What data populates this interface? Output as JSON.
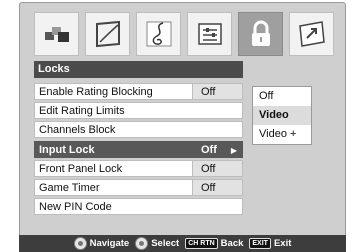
{
  "tabs": [
    {
      "icon": "picture-icon"
    },
    {
      "icon": "screen-icon"
    },
    {
      "icon": "music-icon"
    },
    {
      "icon": "settings-sliders-icon"
    },
    {
      "icon": "lock-icon",
      "active": true
    },
    {
      "icon": "setup-icon"
    }
  ],
  "panel": {
    "title": "Locks",
    "rows": [
      {
        "label": "Enable Rating Blocking",
        "value": "Off"
      },
      {
        "label": "Edit Rating Limits",
        "value": ""
      },
      {
        "label": "Channels Block",
        "value": ""
      },
      {
        "label": "Input Lock",
        "value": "Off",
        "selected": true
      },
      {
        "label": "Front Panel Lock",
        "value": "Off"
      },
      {
        "label": "Game Timer",
        "value": "Off"
      },
      {
        "label": "New PIN Code",
        "value": ""
      }
    ]
  },
  "submenu": {
    "options": [
      "Off",
      "Video",
      "Video +"
    ],
    "highlighted_index": 1
  },
  "footer": {
    "navigate": "Navigate",
    "select": "Select",
    "back_key": "CH RTN",
    "back": "Back",
    "exit_key": "EXIT",
    "exit": "Exit"
  }
}
